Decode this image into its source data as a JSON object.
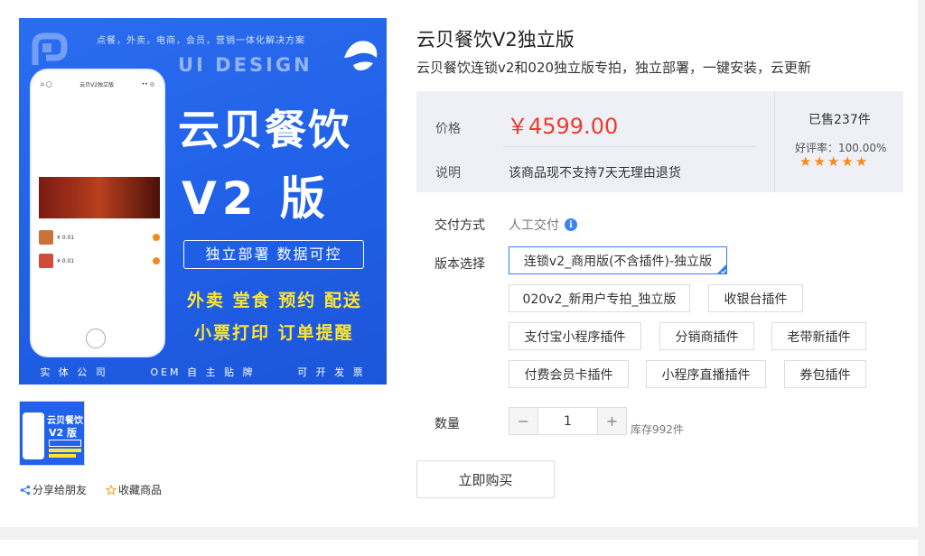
{
  "gallery": {
    "slogan": "点餐，外卖，电商，会员，营销一体化解决方案",
    "ui_design": "UI DESIGN",
    "big_title": "云贝餐饮",
    "big_version": "V2 版",
    "feature_box": "独立部署   数据可控",
    "yellow_line1": "外卖  堂食  预约  配送",
    "yellow_line2": "小票打印  订单提醒",
    "footer": [
      "实 体 公 司",
      "OEM 自 主 贴 牌",
      "可 开 发 票"
    ],
    "phone": {
      "app_title": "云贝V2独立版",
      "prices": [
        "¥ 0.01",
        "¥ 0.01"
      ]
    },
    "thumb": {
      "title": "云贝餐饮",
      "version": "V2 版"
    }
  },
  "actions": {
    "share": "分享给朋友",
    "collect": "收藏商品"
  },
  "product": {
    "title": "云贝餐饮V2独立版",
    "subtitle": "云贝餐饮连锁v2和020独立版专拍，独立部署，一键安装，云更新"
  },
  "price_box": {
    "price_label": "价格",
    "price_value": "￥4599.00",
    "note_label": "说明",
    "note_value": "该商品现不支持7天无理由退货",
    "sold": "已售237件",
    "rating": "好评率：100.00%",
    "stars": 5
  },
  "delivery": {
    "label": "交付方式",
    "value": "人工交付"
  },
  "versions": {
    "label": "版本选择",
    "options": [
      "连锁v2_商用版(不含插件)-独立版",
      "020v2_新用户专拍_独立版",
      "收银台插件",
      "支付宝小程序插件",
      "分销商插件",
      "老带新插件",
      "付费会员卡插件",
      "小程序直播插件",
      "券包插件"
    ],
    "selected": "连锁v2_商用版(不含插件)-独立版"
  },
  "quantity": {
    "label": "数量",
    "value": "1",
    "stock": "库存992件"
  },
  "buy_button": "立即购买",
  "colors": {
    "price": "#f03a2e",
    "star": "#f68a1e",
    "selected_border": "#3a7cf0",
    "banner_blue": "#2262eb"
  }
}
